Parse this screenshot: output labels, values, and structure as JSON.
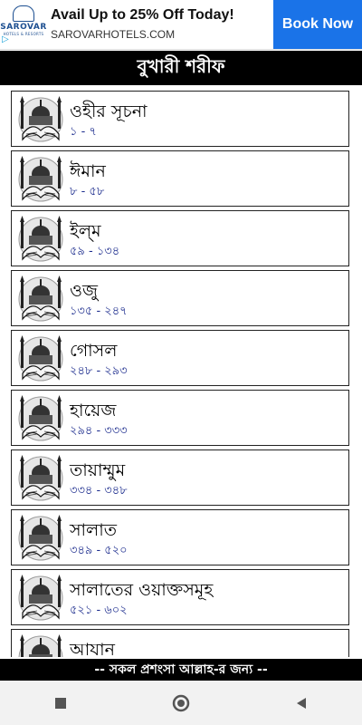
{
  "ad": {
    "logo_brand": "SAROVAR",
    "logo_sub": "HOTELS & RESORTS",
    "title": "Avail Up to 25% Off Today!",
    "url": "SAROVARHOTELS.COM",
    "cta": "Book Now",
    "adchoices_icon": "adchoices-triangle-icon"
  },
  "header": {
    "title": "বুখারী শরীফ"
  },
  "chapters": [
    {
      "title": "ওহীর সূচনা",
      "range": "১ - ৭"
    },
    {
      "title": "ঈমান",
      "range": "৮ - ৫৮"
    },
    {
      "title": "ইল্‌ম",
      "range": "৫৯ - ১৩৪"
    },
    {
      "title": "ওজু",
      "range": "১৩৫ - ২৪৭"
    },
    {
      "title": "গোসল",
      "range": "২৪৮ - ২৯৩"
    },
    {
      "title": "হায়েজ",
      "range": "২৯৪ - ৩৩৩"
    },
    {
      "title": "তায়াম্মুম",
      "range": "৩৩৪ - ৩৪৮"
    },
    {
      "title": "সালাত",
      "range": "৩৪৯ - ৫২০"
    },
    {
      "title": "সালাতের ওয়াক্তসমূহ",
      "range": "৫২১ - ৬০২"
    },
    {
      "title": "আযান",
      "range": ""
    }
  ],
  "footer": {
    "text": "-- সকল প্রশংসা আল্লাহ-র জন্য --"
  },
  "navbar": {
    "recents_icon": "square-recents-icon",
    "home_icon": "circle-home-icon",
    "back_icon": "triangle-back-icon"
  },
  "colors": {
    "range_text": "#1f2f8f",
    "cta_bg": "#1a73e8",
    "bar_bg": "#000000"
  }
}
